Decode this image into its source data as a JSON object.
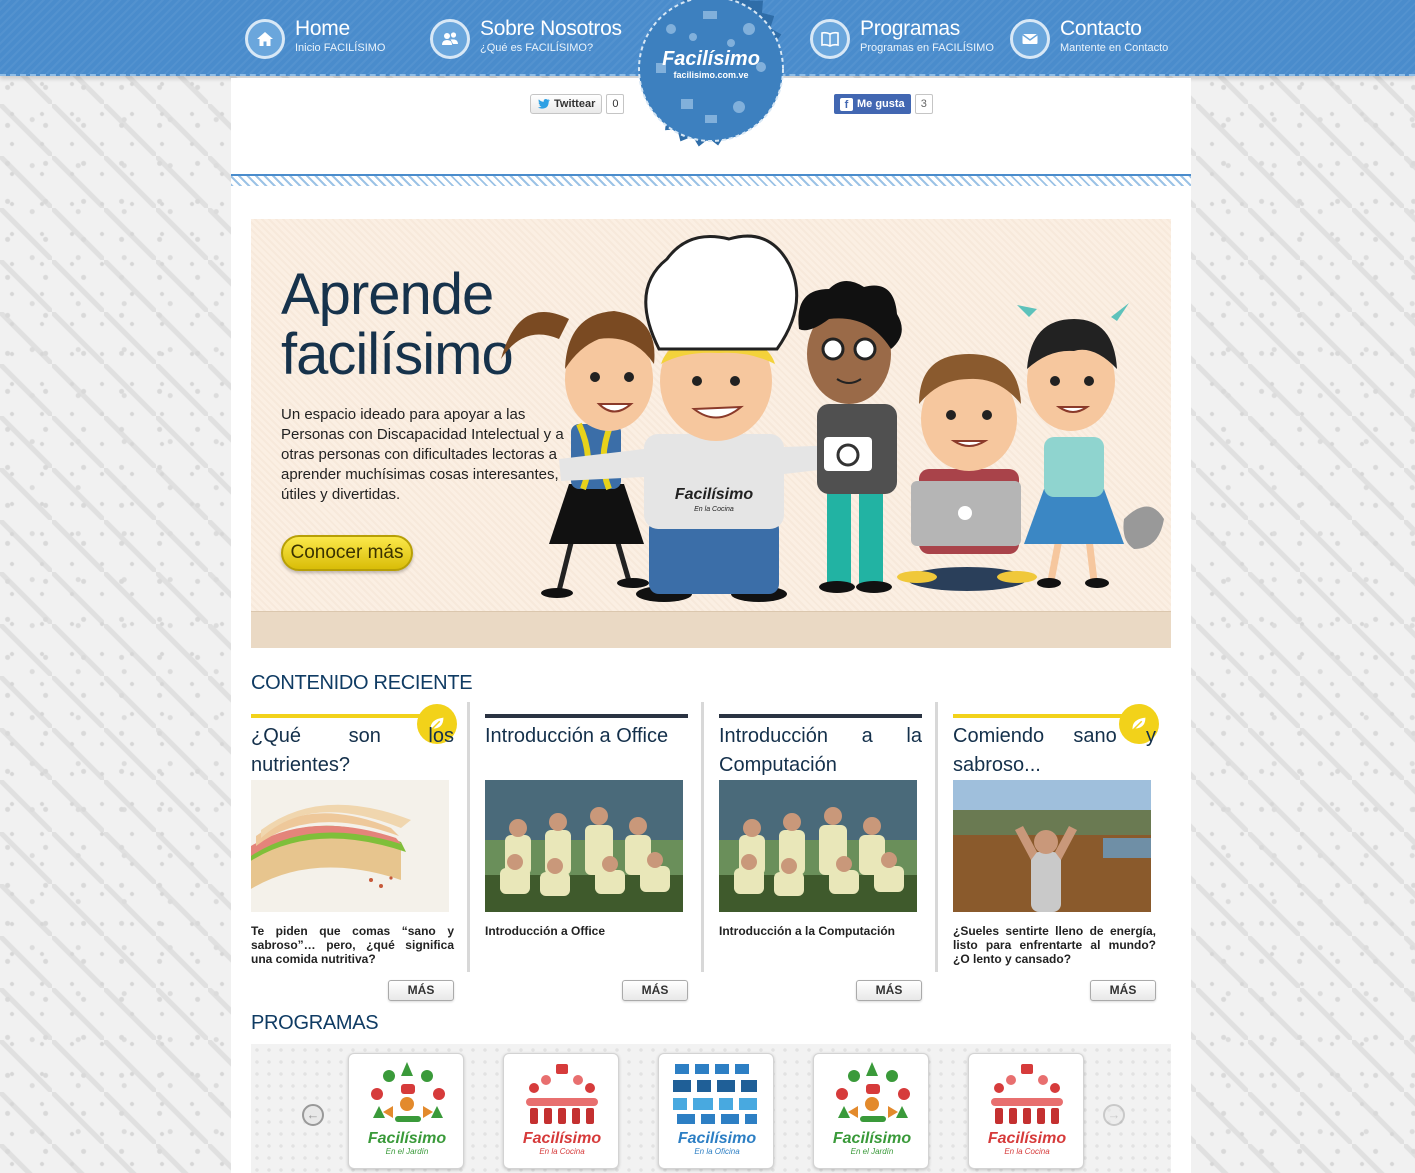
{
  "nav": {
    "items": [
      {
        "title": "Home",
        "sub": "Inicio FACILÍSIMO",
        "icon": "home-icon"
      },
      {
        "title": "Sobre Nosotros",
        "sub": "¿Qué es FACILÍSIMO?",
        "icon": "people-icon"
      },
      {
        "title": "Programas",
        "sub": "Programas en FACILÍSIMO",
        "icon": "book-icon"
      },
      {
        "title": "Contacto",
        "sub": "Mantente en Contacto",
        "icon": "mail-icon"
      }
    ]
  },
  "logo": {
    "name": "Facilísimo",
    "url": "facilisimo.com.ve"
  },
  "social": {
    "twitter_label": "Twittear",
    "twitter_count": "0",
    "facebook_label": "Me gusta",
    "facebook_count": "3"
  },
  "hero": {
    "title_line1": "Aprende",
    "title_line2": "facilísimo",
    "description": "Un espacio ideado para apoyar a las Personas con Discapacidad Intelectual y a otras personas con dificultades lectoras a aprender muchísimas cosas interesantes, útiles y divertidas.",
    "button": "Conocer más",
    "shirt_logo": "Facilísimo",
    "shirt_sub": "En la Cocina"
  },
  "recent": {
    "heading": "CONTENIDO RECIENTE",
    "more_label": "MÁS",
    "cards": [
      {
        "title": "¿Qué son los nutrientes?",
        "text": "Te piden que comas “sano y sabroso”… pero, ¿qué significa una comida nutritiva?",
        "bar_color": "#f2d21a",
        "has_leaf": true
      },
      {
        "title": "Introducción a Office",
        "text": "Introducción a Office",
        "bar_color": "#2a3342",
        "has_leaf": false
      },
      {
        "title": "Introducción a la Computación",
        "text": "Introducción a la Computación",
        "bar_color": "#2a3342",
        "has_leaf": false
      },
      {
        "title": "Comiendo sano y sabroso...",
        "text": "¿Sueles sentirte lleno de energía, listo para enfrentarte al mundo? ¿O lento y cansado?",
        "bar_color": "#f2d21a",
        "has_leaf": true
      }
    ]
  },
  "programs": {
    "heading": "PROGRAMAS",
    "items": [
      {
        "name": "Facilísimo",
        "sub": "En el Jardín",
        "color": "#3a9a3a"
      },
      {
        "name": "Facilísimo",
        "sub": "En la Cocina",
        "color": "#d63b3b"
      },
      {
        "name": "Facilísimo",
        "sub": "En la Oficina",
        "color": "#2d7fc4"
      },
      {
        "name": "Facilísimo",
        "sub": "En el Jardín",
        "color": "#3a9a3a"
      },
      {
        "name": "Facilísimo",
        "sub": "En la Cocina",
        "color": "#d63b3b"
      }
    ]
  },
  "colors": {
    "nav_blue": "#4a8ccc",
    "title_navy": "#0f3b63",
    "accent_yellow": "#f2d21a"
  }
}
